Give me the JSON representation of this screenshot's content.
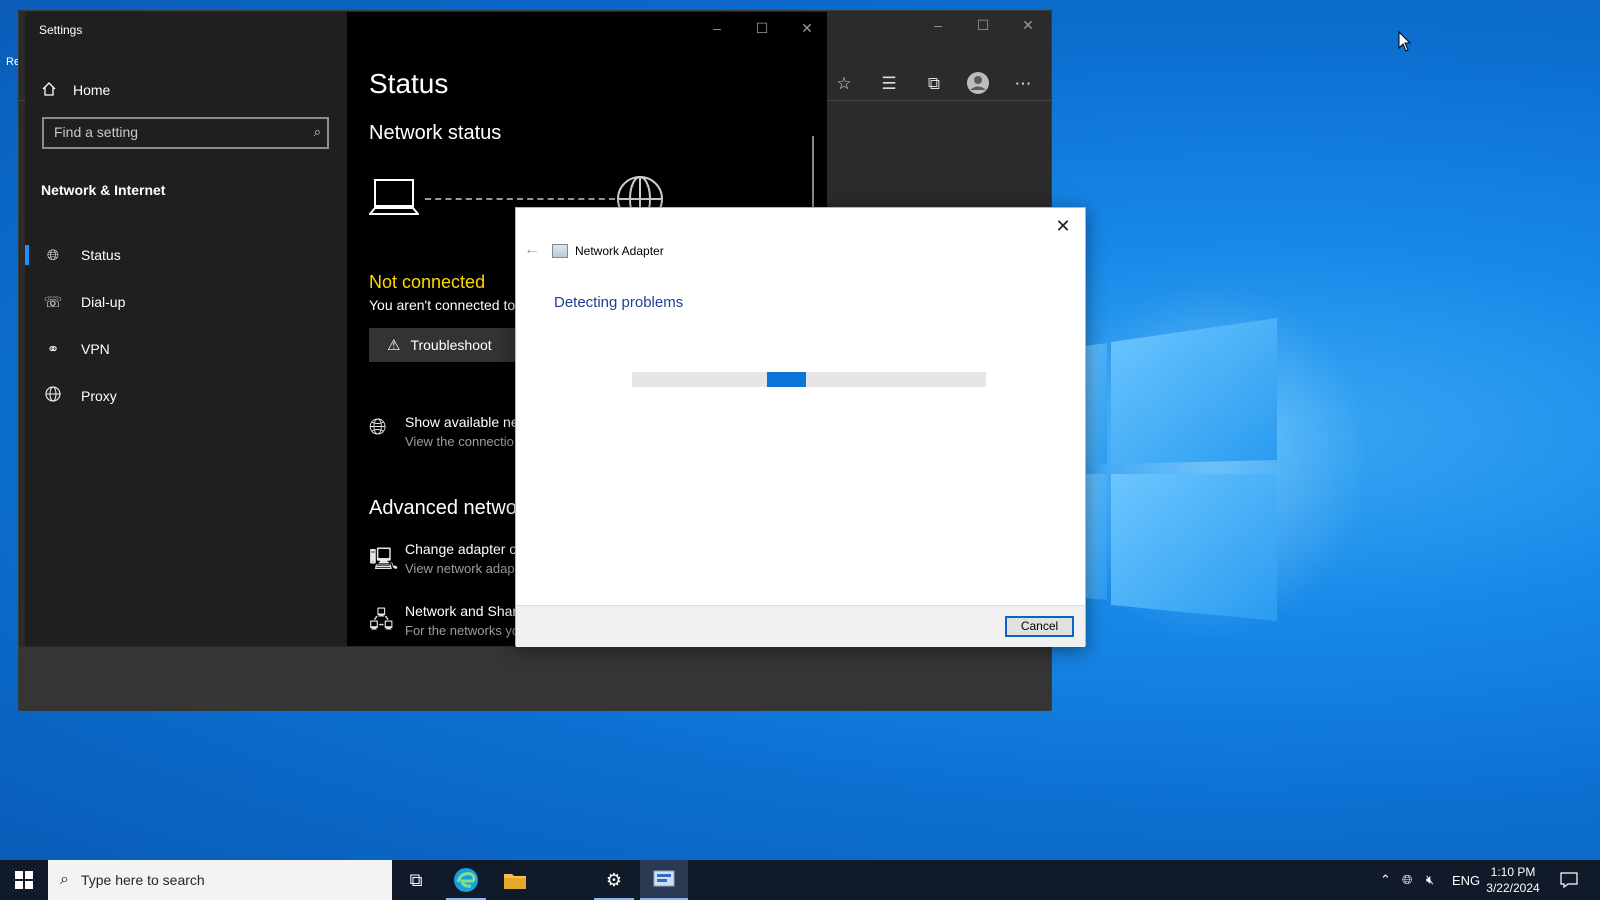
{
  "desktop": {
    "left_edge_fragment": "Re"
  },
  "browser": {
    "window_controls": [
      "–",
      "☐",
      "✕"
    ],
    "toolbar_icons": [
      "favorites-add-icon",
      "favorites-icon",
      "collections-icon",
      "profile-icon",
      "more-icon"
    ]
  },
  "settings": {
    "title": "Settings",
    "home_label": "Home",
    "search_placeholder": "Find a setting",
    "section_title": "Network & Internet",
    "nav": [
      {
        "label": "Status",
        "icon": "status-globe-icon"
      },
      {
        "label": "Dial-up",
        "icon": "dial-up-icon"
      },
      {
        "label": "VPN",
        "icon": "vpn-icon"
      },
      {
        "label": "Proxy",
        "icon": "proxy-globe-icon"
      }
    ],
    "window_controls": [
      "–",
      "☐",
      "✕"
    ],
    "main": {
      "page_title": "Status",
      "network_status_title": "Network status",
      "status_text": "Not connected",
      "status_description": "You aren't connected to",
      "troubleshoot_label": "Troubleshoot",
      "show_networks_title": "Show available ne",
      "show_networks_sub": "View the connectio",
      "advanced_title": "Advanced netwo",
      "change_adapter_title": "Change adapter o",
      "change_adapter_sub": "View network adap",
      "sharing_title": "Network and Shar",
      "sharing_sub": "For the networks yo"
    }
  },
  "dialog": {
    "app_title": "Network Adapter",
    "heading": "Detecting problems",
    "cancel_label": "Cancel",
    "progress_position": 0.43
  },
  "taskbar": {
    "search_placeholder": "Type here to search",
    "language": "ENG",
    "time": "1:10 PM",
    "date": "3/22/2024"
  },
  "colors": {
    "accent": "#0a74d7",
    "warning_yellow": "#ffd800",
    "dialog_heading": "#1e3f94"
  }
}
